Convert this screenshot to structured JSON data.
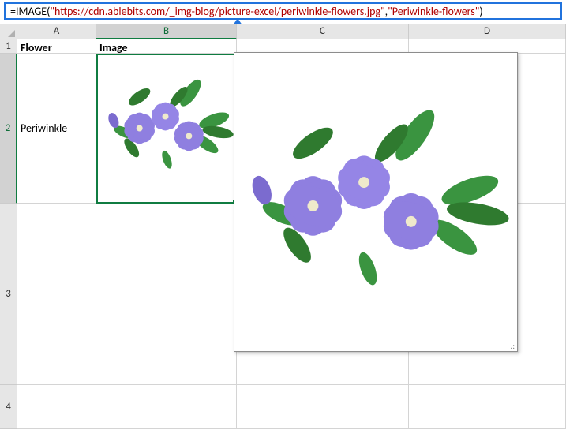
{
  "formula": {
    "eq": "=",
    "fn1": "IMAGE(",
    "str1": "\"https://cdn.ablebits.com/_img-blog/picture-excel/periwinkle-flowers.jpg\"",
    "sep": ", ",
    "str2": "\"Periwinkle-flowers\"",
    "fn2": ")"
  },
  "columns": {
    "A": "A",
    "B": "B",
    "C": "C",
    "D": "D"
  },
  "rows": {
    "1": "1",
    "2": "2",
    "3": "3",
    "4": "4"
  },
  "cells": {
    "A1": "Flower",
    "B1": "Image",
    "A2": "Periwinkle"
  },
  "layout": {
    "rowHeaderW": 22,
    "colHeaderH": 20,
    "colA_w": 100,
    "colB_w": 178,
    "colC_w": 218,
    "colD_w": 199,
    "row1_h": 18,
    "row2_h": 190,
    "row3_h": 230,
    "row4_h": 56
  }
}
